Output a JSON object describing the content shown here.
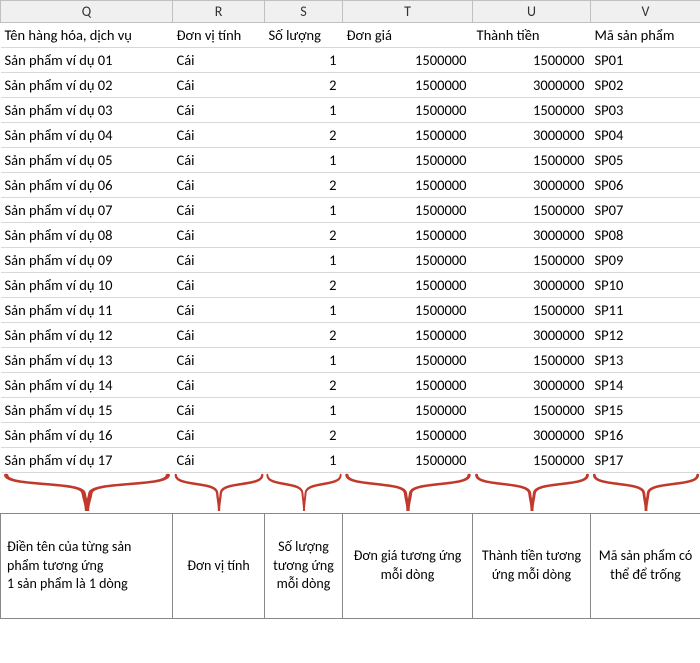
{
  "columns": {
    "q": "Q",
    "r": "R",
    "s": "S",
    "t": "T",
    "u": "U",
    "v": "V"
  },
  "headers": {
    "q": "Tên hàng hóa, dịch vụ",
    "r": "Đơn vị tính",
    "s": "Số lượng",
    "t": "Đơn giá",
    "u": "Thành tiền",
    "v": "Mã sản phẩm"
  },
  "rows": [
    {
      "name": "Sản phẩm ví dụ 01",
      "unit": "Cái",
      "qty": "1",
      "price": "1500000",
      "total": "1500000",
      "code": "SP01"
    },
    {
      "name": "Sản phẩm ví dụ 02",
      "unit": "Cái",
      "qty": "2",
      "price": "1500000",
      "total": "3000000",
      "code": "SP02"
    },
    {
      "name": "Sản phẩm ví dụ 03",
      "unit": "Cái",
      "qty": "1",
      "price": "1500000",
      "total": "1500000",
      "code": "SP03"
    },
    {
      "name": "Sản phẩm ví dụ 04",
      "unit": "Cái",
      "qty": "2",
      "price": "1500000",
      "total": "3000000",
      "code": "SP04"
    },
    {
      "name": "Sản phẩm ví dụ 05",
      "unit": "Cái",
      "qty": "1",
      "price": "1500000",
      "total": "1500000",
      "code": "SP05"
    },
    {
      "name": "Sản phẩm ví dụ 06",
      "unit": "Cái",
      "qty": "2",
      "price": "1500000",
      "total": "3000000",
      "code": "SP06"
    },
    {
      "name": "Sản phẩm ví dụ 07",
      "unit": "Cái",
      "qty": "1",
      "price": "1500000",
      "total": "1500000",
      "code": "SP07"
    },
    {
      "name": "Sản phẩm ví dụ 08",
      "unit": "Cái",
      "qty": "2",
      "price": "1500000",
      "total": "3000000",
      "code": "SP08"
    },
    {
      "name": "Sản phẩm ví dụ 09",
      "unit": "Cái",
      "qty": "1",
      "price": "1500000",
      "total": "1500000",
      "code": "SP09"
    },
    {
      "name": "Sản phẩm ví dụ 10",
      "unit": "Cái",
      "qty": "2",
      "price": "1500000",
      "total": "3000000",
      "code": "SP10"
    },
    {
      "name": "Sản phẩm ví dụ 11",
      "unit": "Cái",
      "qty": "1",
      "price": "1500000",
      "total": "1500000",
      "code": "SP11"
    },
    {
      "name": "Sản phẩm ví dụ 12",
      "unit": "Cái",
      "qty": "2",
      "price": "1500000",
      "total": "3000000",
      "code": "SP12"
    },
    {
      "name": "Sản phẩm ví dụ 13",
      "unit": "Cái",
      "qty": "1",
      "price": "1500000",
      "total": "1500000",
      "code": "SP13"
    },
    {
      "name": "Sản phẩm ví dụ 14",
      "unit": "Cái",
      "qty": "2",
      "price": "1500000",
      "total": "3000000",
      "code": "SP14"
    },
    {
      "name": "Sản phẩm ví dụ 15",
      "unit": "Cái",
      "qty": "1",
      "price": "1500000",
      "total": "1500000",
      "code": "SP15"
    },
    {
      "name": "Sản phẩm ví dụ 16",
      "unit": "Cái",
      "qty": "2",
      "price": "1500000",
      "total": "3000000",
      "code": "SP16"
    },
    {
      "name": "Sản phẩm ví dụ 17",
      "unit": "Cái",
      "qty": "1",
      "price": "1500000",
      "total": "1500000",
      "code": "SP17"
    }
  ],
  "notes": {
    "q": "Điền tên của từng sản phẩm tương ứng\n1 sản phẩm là 1 dòng",
    "r": "Đơn vị tính",
    "s": "Số lượng tương ứng mỗi dòng",
    "t": "Đơn giá tương ứng mỗi dòng",
    "u": "Thành tiền tương ứng mỗi dòng",
    "v": "Mã sản phẩm có thể để trống"
  },
  "colors": {
    "brace": "#c0392b"
  }
}
